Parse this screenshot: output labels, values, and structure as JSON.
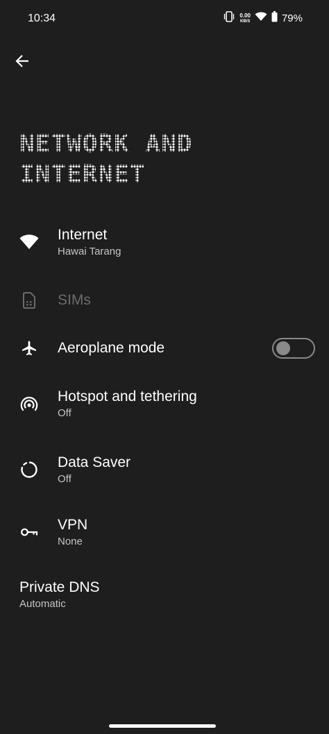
{
  "status_bar": {
    "time": "10:34",
    "net_speed_value": "0.00",
    "net_speed_unit": "KB/S",
    "battery_percent": "79%"
  },
  "header": {
    "title": "NETWORK AND INTERNET"
  },
  "settings": {
    "internet": {
      "title": "Internet",
      "subtitle": "Hawai Tarang",
      "icon": "wifi-icon"
    },
    "sims": {
      "title": "SIMs",
      "icon": "sim-card-icon",
      "disabled": true
    },
    "aeroplane": {
      "title": "Aeroplane mode",
      "icon": "airplane-icon",
      "toggle_on": false
    },
    "hotspot": {
      "title": "Hotspot and tethering",
      "subtitle": "Off",
      "icon": "hotspot-icon"
    },
    "data_saver": {
      "title": "Data Saver",
      "subtitle": "Off",
      "icon": "data-saver-icon"
    },
    "vpn": {
      "title": "VPN",
      "subtitle": "None",
      "icon": "key-icon"
    },
    "private_dns": {
      "title": "Private DNS",
      "subtitle": "Automatic"
    }
  }
}
